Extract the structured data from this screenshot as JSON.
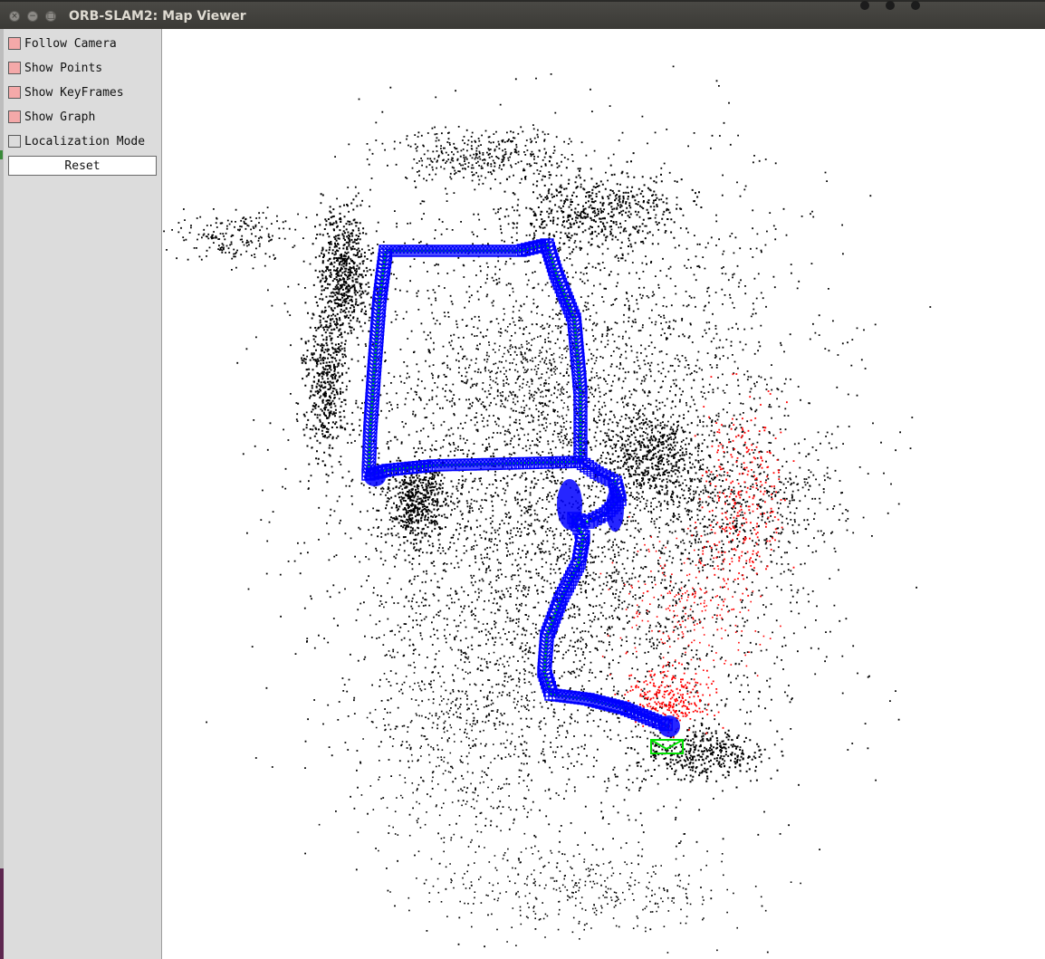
{
  "window": {
    "title": "ORB-SLAM2: Map Viewer",
    "buttons": [
      "close",
      "minimize",
      "maximize"
    ]
  },
  "panel": {
    "options": [
      {
        "label": "Follow Camera",
        "checked": true
      },
      {
        "label": "Show Points",
        "checked": true
      },
      {
        "label": "Show KeyFrames",
        "checked": true
      },
      {
        "label": "Show Graph",
        "checked": true
      },
      {
        "label": "Localization Mode",
        "checked": false
      }
    ],
    "reset_label": "Reset"
  },
  "colors": {
    "map_points": "#000000",
    "reference_points": "#ff0000",
    "keyframes": "#0000ff",
    "graph_edges": "#00e000",
    "checked_box": "#f4a9a9",
    "panel_bg": "#dcdcdc"
  }
}
